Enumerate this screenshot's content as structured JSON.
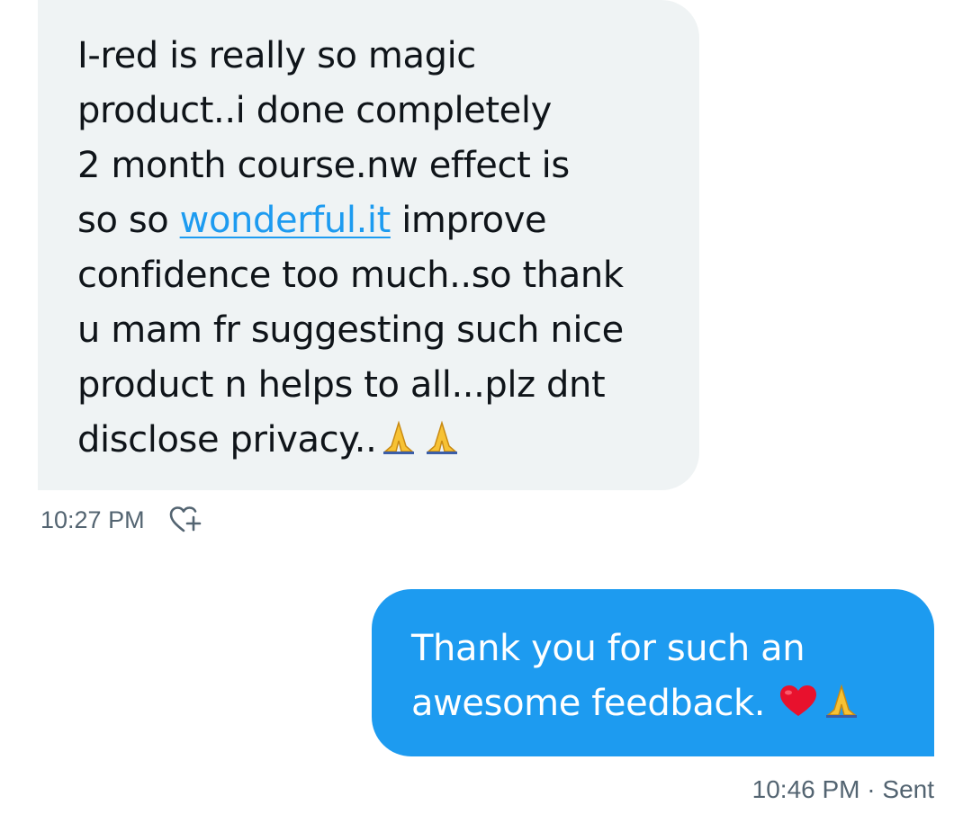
{
  "received_message": {
    "lines": [
      "I-red is really so magic",
      "product..i done completely",
      "2 month course.nw effect is",
      "so so ",
      "confidence too much..so thank",
      "u mam fr suggesting such nice",
      "product n helps to all...plz dnt",
      "disclose privacy.."
    ],
    "link_text": "wonderful.it",
    "after_link": " improve",
    "emoji": [
      "folded-hands",
      "folded-hands"
    ],
    "timestamp": "10:27 PM",
    "reaction_icon": "heart-plus-icon"
  },
  "sent_message": {
    "lines": [
      "Thank you for such an",
      "awesome feedback. "
    ],
    "emoji": [
      "red-heart",
      "folded-hands"
    ],
    "timestamp": "10:46 PM",
    "separator": " · ",
    "status": "Sent"
  },
  "colors": {
    "received_bubble": "#eff3f4",
    "sent_bubble": "#1d9bf0",
    "link": "#1d9bf0",
    "meta_text": "#536471"
  }
}
